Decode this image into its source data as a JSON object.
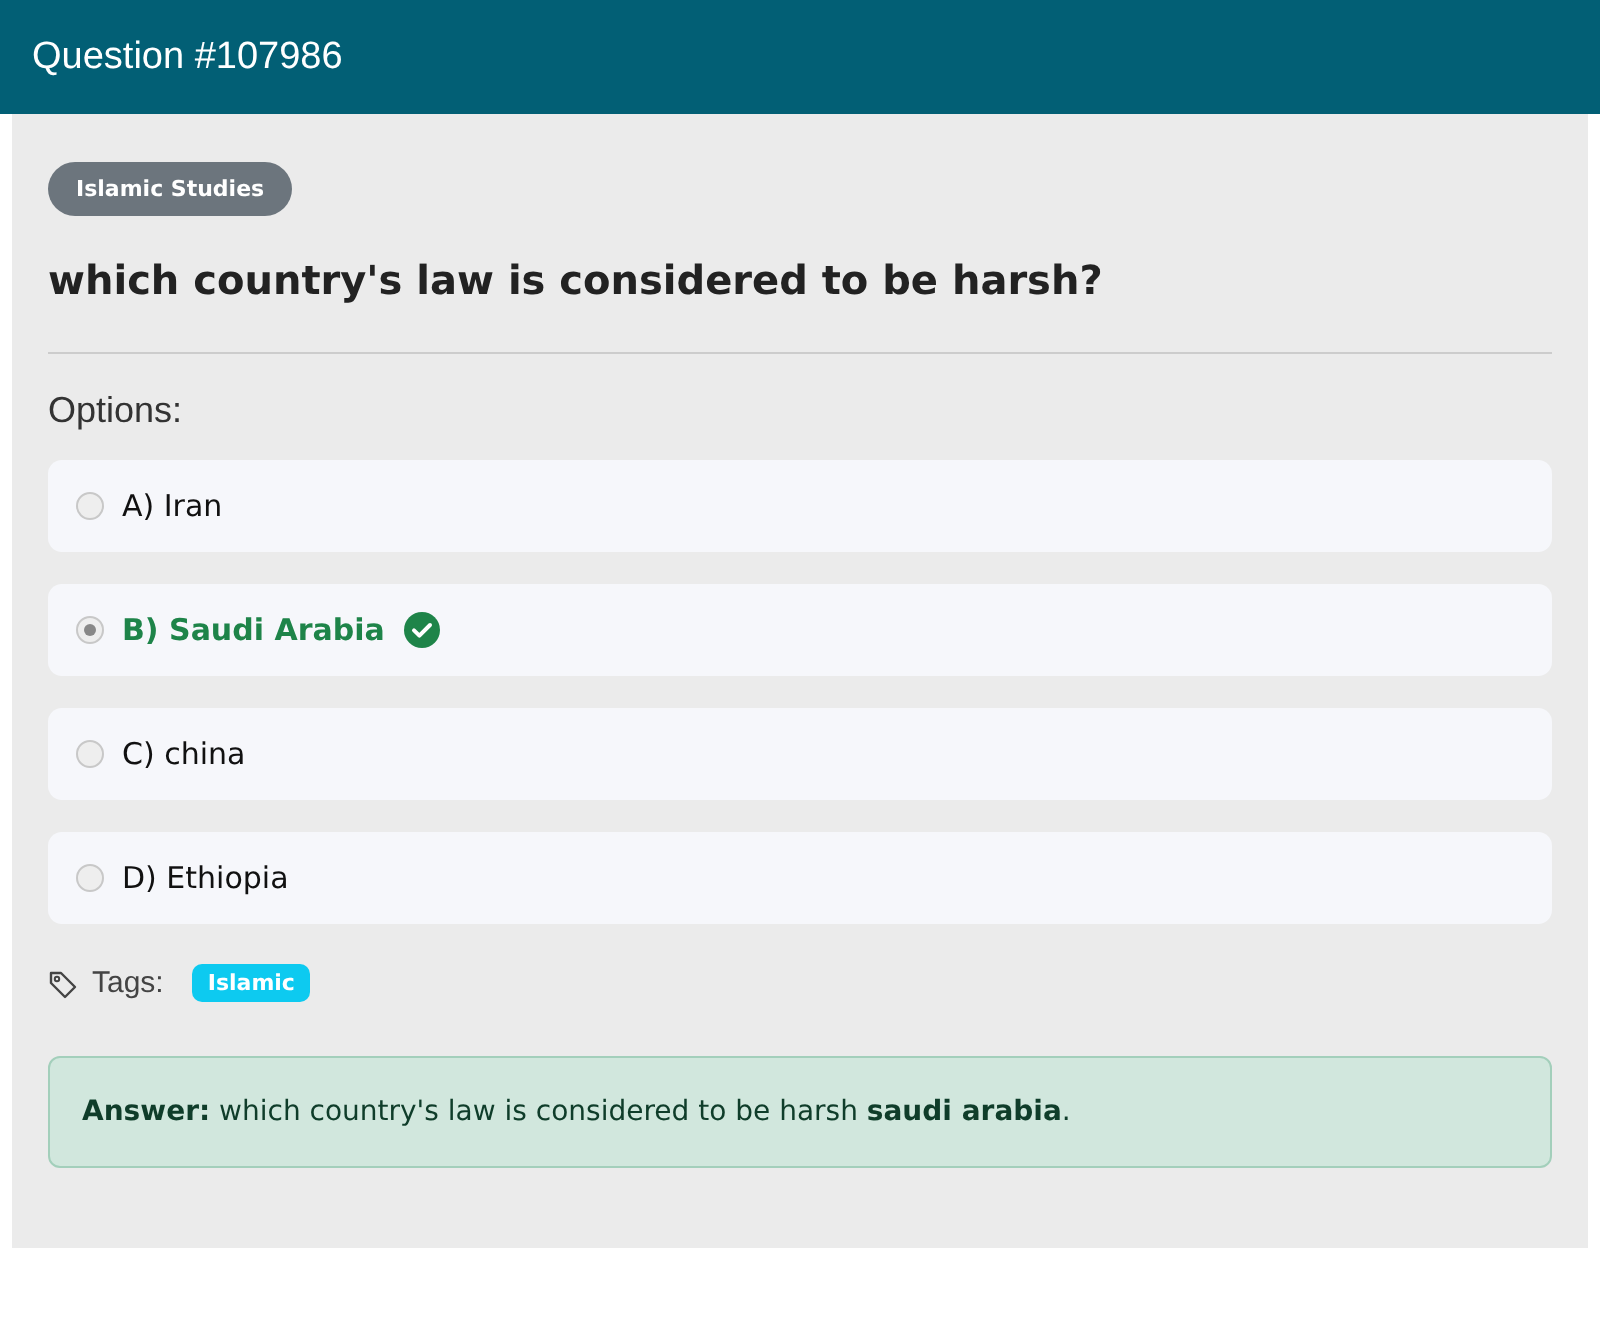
{
  "header": {
    "title": "Question #107986"
  },
  "category": "Islamic Studies",
  "question": "which country's law is considered to be harsh?",
  "options_label": "Options:",
  "options": [
    {
      "text": "A) Iran",
      "selected": false,
      "correct": false
    },
    {
      "text": "B) Saudi Arabia",
      "selected": true,
      "correct": true
    },
    {
      "text": "C) china",
      "selected": false,
      "correct": false
    },
    {
      "text": "D) Ethiopia",
      "selected": false,
      "correct": false
    }
  ],
  "tags_label": "Tags:",
  "tags": [
    "Islamic"
  ],
  "answer": "**Answer:** which country's law is considered to be harsh **saudi arabia**."
}
